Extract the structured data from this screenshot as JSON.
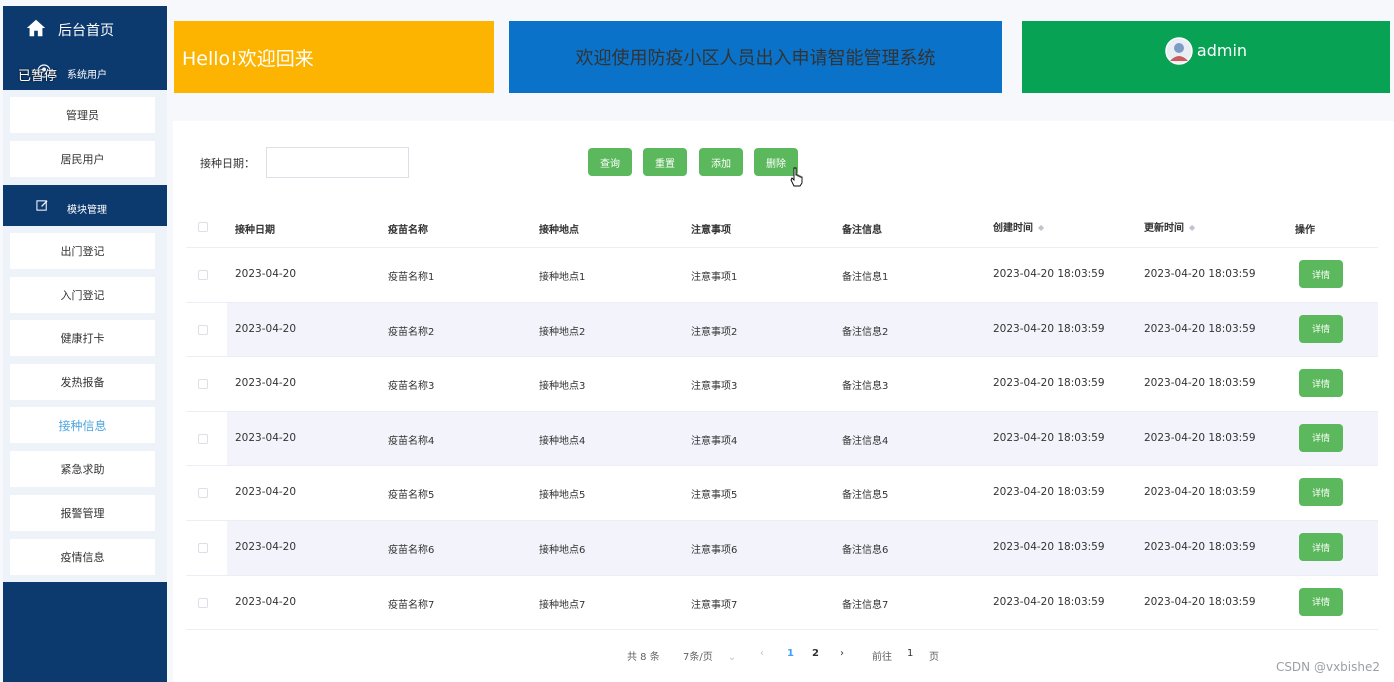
{
  "sidebar": {
    "home_label": "后台首页",
    "paused_badge": "已暂停",
    "group_system_label": "系统用户",
    "system_items": [
      {
        "label": "管理员"
      },
      {
        "label": "居民用户"
      }
    ],
    "group_module_label": "模块管理",
    "module_items": [
      {
        "label": "出门登记"
      },
      {
        "label": "入门登记"
      },
      {
        "label": "健康打卡"
      },
      {
        "label": "发热报备"
      },
      {
        "label": "接种信息"
      },
      {
        "label": "紧急求助"
      },
      {
        "label": "报警管理"
      },
      {
        "label": "疫情信息"
      }
    ],
    "active_item": "接种信息"
  },
  "header": {
    "hello": "Hello!欢迎回来",
    "welcome": "欢迎使用防疫小区人员出入申请智能管理系统",
    "username": "admin"
  },
  "search": {
    "label": "接种日期：",
    "value": "",
    "placeholder": ""
  },
  "toolbar": {
    "query": "查询",
    "reset": "重置",
    "add": "添加",
    "delete": "删除"
  },
  "table": {
    "headers": {
      "date": "接种日期",
      "vaccine": "疫苗名称",
      "location": "接种地点",
      "notes": "注意事项",
      "remarks": "备注信息",
      "created": "创建时间",
      "updated": "更新时间",
      "actions": "操作"
    },
    "detail_label": "详情",
    "rows": [
      {
        "date": "2023-04-20",
        "vaccine": "疫苗名称1",
        "location": "接种地点1",
        "notes": "注意事项1",
        "remarks": "备注信息1",
        "created": "2023-04-20 18:03:59",
        "updated": "2023-04-20 18:03:59"
      },
      {
        "date": "2023-04-20",
        "vaccine": "疫苗名称2",
        "location": "接种地点2",
        "notes": "注意事项2",
        "remarks": "备注信息2",
        "created": "2023-04-20 18:03:59",
        "updated": "2023-04-20 18:03:59"
      },
      {
        "date": "2023-04-20",
        "vaccine": "疫苗名称3",
        "location": "接种地点3",
        "notes": "注意事项3",
        "remarks": "备注信息3",
        "created": "2023-04-20 18:03:59",
        "updated": "2023-04-20 18:03:59"
      },
      {
        "date": "2023-04-20",
        "vaccine": "疫苗名称4",
        "location": "接种地点4",
        "notes": "注意事项4",
        "remarks": "备注信息4",
        "created": "2023-04-20 18:03:59",
        "updated": "2023-04-20 18:03:59"
      },
      {
        "date": "2023-04-20",
        "vaccine": "疫苗名称5",
        "location": "接种地点5",
        "notes": "注意事项5",
        "remarks": "备注信息5",
        "created": "2023-04-20 18:03:59",
        "updated": "2023-04-20 18:03:59"
      },
      {
        "date": "2023-04-20",
        "vaccine": "疫苗名称6",
        "location": "接种地点6",
        "notes": "注意事项6",
        "remarks": "备注信息6",
        "created": "2023-04-20 18:03:59",
        "updated": "2023-04-20 18:03:59"
      },
      {
        "date": "2023-04-20",
        "vaccine": "疫苗名称7",
        "location": "接种地点7",
        "notes": "注意事项7",
        "remarks": "备注信息7",
        "created": "2023-04-20 18:03:59",
        "updated": "2023-04-20 18:03:59"
      }
    ]
  },
  "pagination": {
    "total": "共 8 条",
    "page_size": "7条/页",
    "pages": [
      "1",
      "2"
    ],
    "current_page": "1",
    "goto_label": "前往",
    "goto_value": "1",
    "page_suffix": "页"
  },
  "watermark": "CSDN @vxbishe2",
  "colors": {
    "sidebar_bg": "#0c3a6e",
    "hello_card": "#fcb400",
    "welcome_card": "#0a72c9",
    "admin_card": "#07a254",
    "button_green": "#5cb85c",
    "active_link": "#4ea6de"
  },
  "icons": {
    "home": "home-icon",
    "system_users": "user-circle-icon",
    "module": "edit-icon",
    "avatar": "avatar-icon",
    "sort": "sort-caret-icon",
    "prev": "chevron-left-icon",
    "next": "chevron-right-icon",
    "select": "chevron-down-icon",
    "cursor": "hand-pointer-icon"
  }
}
